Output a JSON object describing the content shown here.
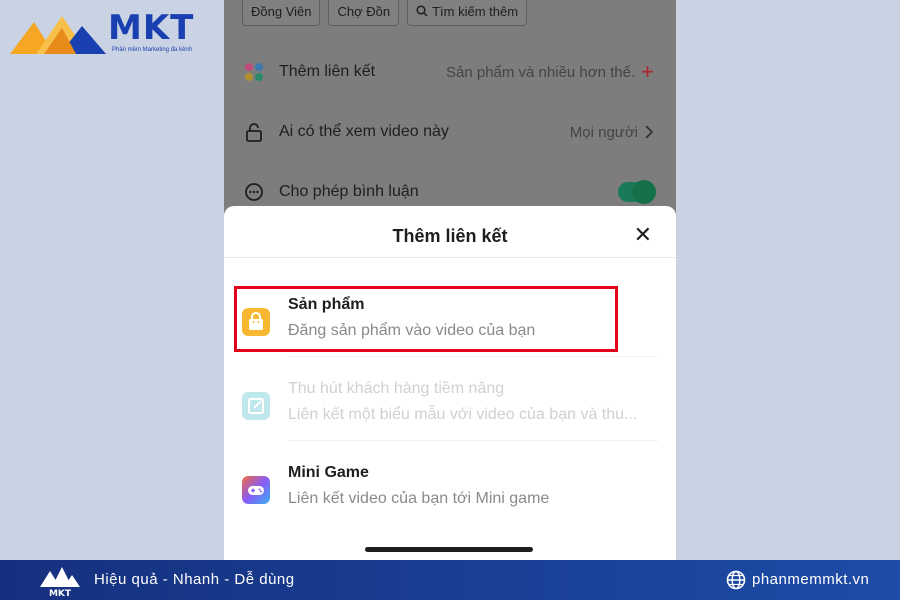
{
  "logo": {
    "brand": "MKT",
    "tagline": "Phần mềm Marketing đa kênh"
  },
  "background": {
    "chips": [
      "Đồng Viên",
      "Chợ Đồn",
      "Tìm kiếm thêm"
    ],
    "rows": [
      {
        "label": "Thêm liên kết",
        "value": "Sản phẩm và nhiều hơn thế."
      },
      {
        "label": "Ai có thể xem video này",
        "value": "Mọi người"
      },
      {
        "label": "Cho phép bình luận"
      }
    ]
  },
  "sheet": {
    "title": "Thêm liên kết",
    "options": [
      {
        "title": "Sản phẩm",
        "description": "Đăng sản phẩm vào video của bạn"
      },
      {
        "title": "Thu hút khách hàng tiềm năng",
        "description": "Liên kết một biểu mẫu với video của bạn và thu..."
      },
      {
        "title": "Mini Game",
        "description": "Liên kết video của bạn tới Mini game"
      }
    ]
  },
  "footer": {
    "slogan": "Hiệu quả - Nhanh - Dễ dùng",
    "website": "phanmemmkt.vn"
  },
  "colors": {
    "brand": "#1a3fb0",
    "highlight": "#e2001a",
    "toggle": "#137049",
    "footer": "#1e4ca8"
  }
}
